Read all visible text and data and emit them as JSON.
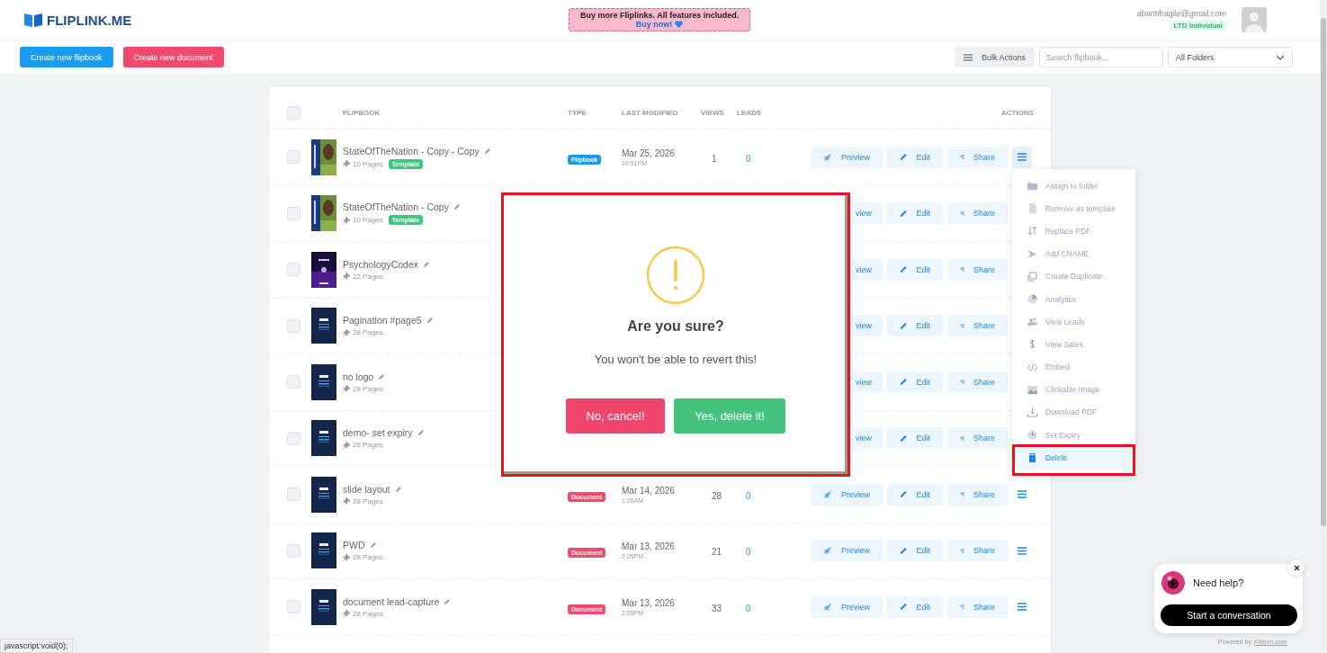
{
  "header": {
    "logo": "FLIPLINK.ME",
    "promo": {
      "line1": "Buy more Fliplinks. All features included.",
      "line2": "Buy now!"
    },
    "user": {
      "email": "abantifragile@gmail.com",
      "plan": "LTD Individual"
    }
  },
  "toolbar": {
    "create_flipbook": "Create new flipbook",
    "create_document": "Create new document",
    "bulk_actions": "Bulk Actions",
    "search": {
      "placeholder": "Search flipbook..."
    },
    "folder_select": "All Folders"
  },
  "table": {
    "select_all": {
      "checked": false
    },
    "columns": [
      "FLIPBOOK",
      "TYPE",
      "LAST MODIFIED",
      "VIEWS",
      "LEADS",
      "ACTIONS"
    ],
    "rows": [
      {
        "checked": false,
        "title": "StateOfTheNation - Copy - Copy",
        "pages": "10 Pages",
        "template": "Template",
        "type": {
          "label": "Flipbook",
          "color": "#1a9bf0"
        },
        "date": "Mar 25, 2026",
        "time": "10:51PM",
        "views": "1",
        "leads": "0",
        "preview": "Preview",
        "edit": "Edit",
        "share": "Share",
        "menu_open": true
      },
      {
        "checked": false,
        "title": "StateOfTheNation - Copy",
        "pages": "10 Pages",
        "template": "Template",
        "preview": "view",
        "edit": "Edit",
        "share": "Share"
      },
      {
        "checked": false,
        "title": "PsychologyCodex",
        "pages": "22 Pages",
        "preview": "view",
        "edit": "Edit",
        "share": "Share"
      },
      {
        "checked": false,
        "title": "Pagination #page5",
        "pages": "28 Pages",
        "preview": "view",
        "edit": "Edit",
        "share": "Share"
      },
      {
        "checked": false,
        "title": "no logo",
        "pages": "28 Pages",
        "preview": "view",
        "edit": "Edit",
        "share": "Share"
      },
      {
        "checked": false,
        "title": "demo- set expiry",
        "pages": "28 Pages",
        "preview": "view",
        "edit": "Edit",
        "share": "Share"
      },
      {
        "checked": false,
        "title": "slide layout",
        "pages": "28 Pages",
        "type": {
          "label": "Document",
          "color": "#f04a6f"
        },
        "date": "Mar 14, 2026",
        "time": "1:26AM",
        "views": "28",
        "leads": "0",
        "preview": "Preview",
        "edit": "Edit",
        "share": "Share",
        "menu_open": false
      },
      {
        "checked": false,
        "title": "PWD",
        "pages": "28 Pages",
        "type": {
          "label": "Document",
          "color": "#f04a6f"
        },
        "date": "Mar 13, 2026",
        "time": "2:05PM",
        "views": "21",
        "leads": "0",
        "preview": "Preview",
        "edit": "Edit",
        "share": "Share",
        "menu_open": false
      },
      {
        "checked": false,
        "title": "document lead-capture",
        "pages": "28 Pages",
        "type": {
          "label": "Document",
          "color": "#f04a6f"
        },
        "date": "Mar 13, 2026",
        "time": "2:05PM",
        "views": "33",
        "leads": "0",
        "preview": "Preview",
        "edit": "Edit",
        "share": "Share",
        "menu_open": false
      }
    ]
  },
  "actions_menu": {
    "items": [
      {
        "label": "Assign to folder",
        "selected": false
      },
      {
        "label": "Remove as template",
        "selected": false
      },
      {
        "label": "Replace PDF",
        "selected": false
      },
      {
        "label": "Add CNAME",
        "selected": false
      },
      {
        "label": "Create Duplicate",
        "selected": false
      },
      {
        "label": "Analytics",
        "selected": false
      },
      {
        "label": "View Leads",
        "selected": false
      },
      {
        "label": "View Sales",
        "selected": false
      },
      {
        "label": "Embed",
        "selected": false
      },
      {
        "label": "Clickable Image",
        "selected": false
      },
      {
        "label": "Download PDF",
        "selected": false
      },
      {
        "label": "Set Expiry",
        "selected": false
      },
      {
        "label": "Delete",
        "selected": true
      }
    ]
  },
  "dialog": {
    "title": "Are you sure?",
    "message": "You won't be able to revert this!",
    "cancel": "No, cancel!",
    "confirm": "Yes, delete it!"
  },
  "chat": {
    "prompt": "Need help?",
    "button": "Start a conversation",
    "powered": "Powered by",
    "powered_link": "Kitepin.com"
  },
  "status_bar": "javascript:void(0);"
}
